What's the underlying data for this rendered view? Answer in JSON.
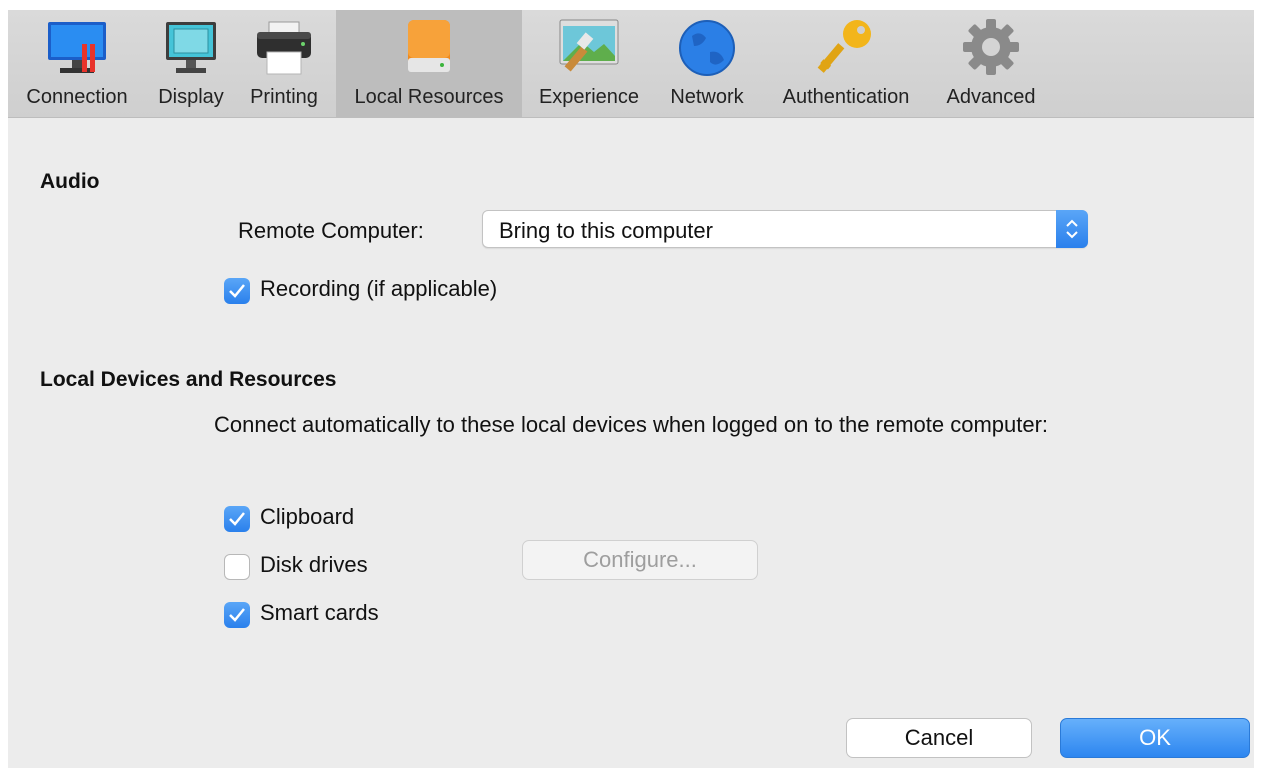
{
  "toolbar": {
    "tabs": [
      {
        "label": "Connection",
        "icon": "monitor-connection-icon"
      },
      {
        "label": "Display",
        "icon": "display-icon"
      },
      {
        "label": "Printing",
        "icon": "printer-icon"
      },
      {
        "label": "Local Resources",
        "icon": "disk-drive-icon",
        "selected": true
      },
      {
        "label": "Experience",
        "icon": "experience-icon"
      },
      {
        "label": "Network",
        "icon": "globe-icon"
      },
      {
        "label": "Authentication",
        "icon": "key-icon"
      },
      {
        "label": "Advanced",
        "icon": "gear-icon"
      }
    ]
  },
  "audio": {
    "title": "Audio",
    "remote_label": "Remote Computer:",
    "remote_value": "Bring to this computer",
    "recording": {
      "label": "Recording (if applicable)",
      "checked": true
    }
  },
  "devices": {
    "title": "Local Devices and Resources",
    "description": "Connect automatically to these local devices when logged on to the remote computer:",
    "clipboard": {
      "label": "Clipboard",
      "checked": true
    },
    "disk_drives": {
      "label": "Disk drives",
      "checked": false
    },
    "configure_label": "Configure...",
    "smart_cards": {
      "label": "Smart cards",
      "checked": true
    }
  },
  "buttons": {
    "cancel": "Cancel",
    "ok": "OK"
  },
  "colors": {
    "accent": "#2a80ec",
    "selected_tab": "#bdbdbd",
    "background": "#ececec"
  }
}
